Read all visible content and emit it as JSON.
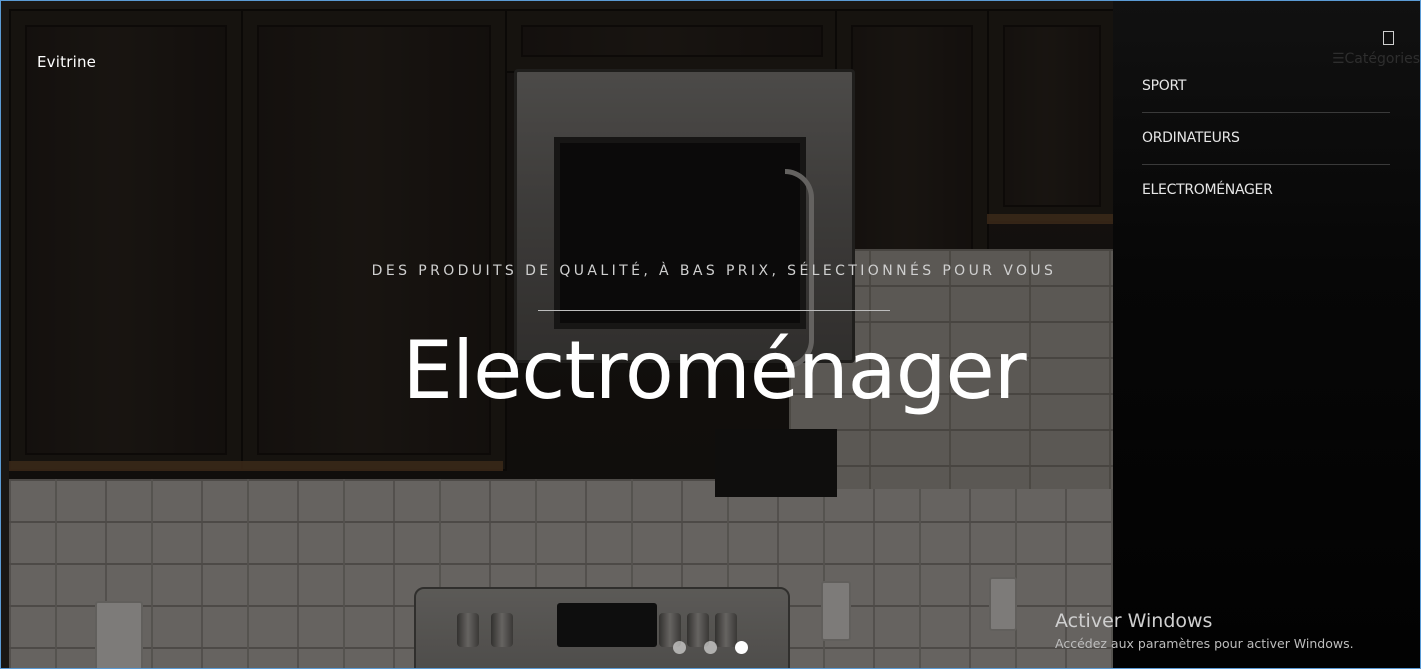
{
  "brand": {
    "name": "Evitrine"
  },
  "hero": {
    "tagline": "DES PRODUITS DE QUALITÉ, À BAS PRIX, SÉLECTIONNÉS POUR VOUS",
    "title": "Electroménager"
  },
  "carousel": {
    "slides": 3,
    "active_index": 2
  },
  "side_menu": {
    "toggle_label": "☰Catégories",
    "items": [
      {
        "label": "SPORT"
      },
      {
        "label": "ORDINATEURS"
      },
      {
        "label": "ELECTROMÉNAGER"
      }
    ]
  },
  "watermark": {
    "title": "Activer Windows",
    "subtitle": "Accédez aux paramètres pour activer Windows."
  },
  "colors": {
    "accent_border": "#5b9bd5",
    "menu_bg": "#050505",
    "text_primary": "#ffffff"
  }
}
